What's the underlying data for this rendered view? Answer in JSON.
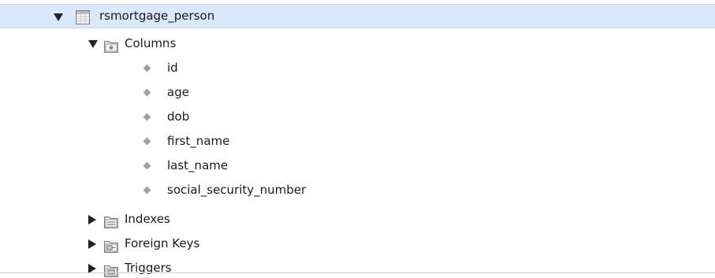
{
  "tree": {
    "table": {
      "name": "rsmortgage_person",
      "expanded": true,
      "selected": true,
      "icon": "table-icon"
    },
    "columns_folder": {
      "label": "Columns",
      "expanded": true,
      "icon": "columns-folder-icon"
    },
    "columns": [
      "id",
      "age",
      "dob",
      "first_name",
      "last_name",
      "social_security_number"
    ],
    "indexes_folder": {
      "label": "Indexes",
      "expanded": false,
      "icon": "indexes-folder-icon"
    },
    "foreign_keys_folder": {
      "label": "Foreign Keys",
      "expanded": false,
      "icon": "foreign-keys-folder-icon"
    },
    "triggers_folder": {
      "label": "Triggers",
      "expanded": false,
      "icon": "triggers-folder-icon"
    }
  },
  "colors": {
    "selection": "#d9e8fb",
    "column_diamond": "#a0a0a0"
  }
}
